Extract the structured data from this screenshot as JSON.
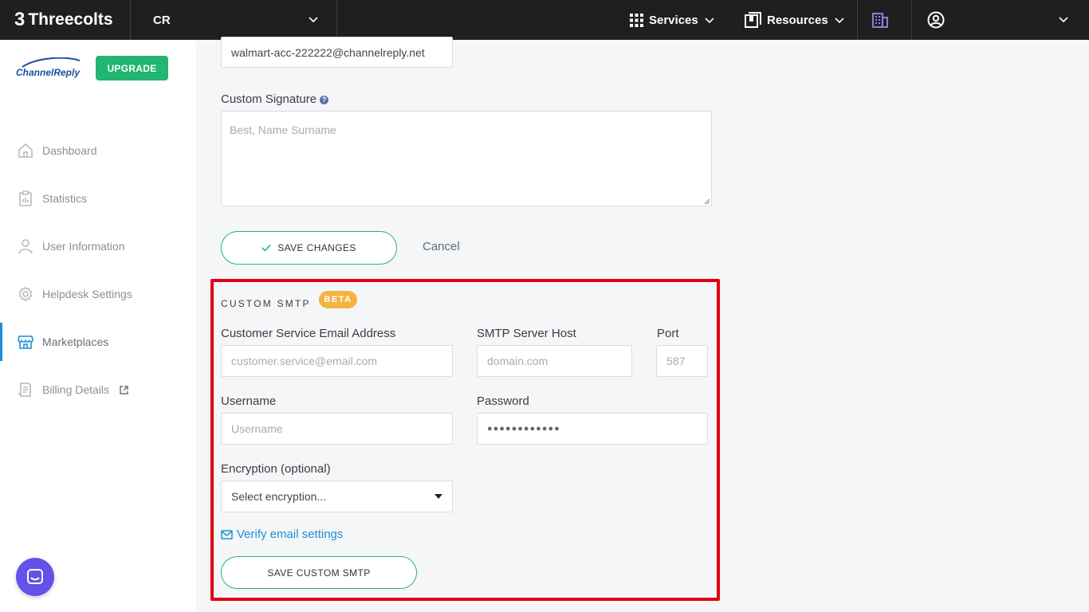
{
  "topbar": {
    "brand": "Threecolts",
    "brand_mark": "3",
    "account": "CR",
    "services_label": "Services",
    "resources_label": "Resources"
  },
  "sidebar": {
    "logo_text": "ChannelReply",
    "upgrade_label": "UPGRADE",
    "items": [
      {
        "label": "Dashboard"
      },
      {
        "label": "Statistics"
      },
      {
        "label": "User Information"
      },
      {
        "label": "Helpdesk Settings"
      },
      {
        "label": "Marketplaces"
      },
      {
        "label": "Billing Details"
      }
    ],
    "active_item": "Marketplaces"
  },
  "form": {
    "email_value": "walmart-acc-222222@channelreply.net",
    "signature_label": "Custom Signature",
    "signature_placeholder": "Best, Name Surname",
    "save_label": "SAVE CHANGES",
    "cancel_label": "Cancel"
  },
  "smtp": {
    "title": "CUSTOM SMTP",
    "badge": "BETA",
    "cs_email_label": "Customer Service Email Address",
    "cs_email_placeholder": "customer.service@email.com",
    "host_label": "SMTP Server Host",
    "host_placeholder": "domain.com",
    "port_label": "Port",
    "port_placeholder": "587",
    "username_label": "Username",
    "username_placeholder": "Username",
    "password_label": "Password",
    "password_value": "●●●●●●●●●●●●",
    "encryption_label": "Encryption (optional)",
    "encryption_value": "Select encryption...",
    "verify_label": "Verify email settings",
    "save_label": "SAVE CUSTOM SMTP"
  },
  "colors": {
    "accent_green": "#22b573",
    "link_blue": "#1e8fd8",
    "highlight_red": "#e00012",
    "beta_orange": "#f5b342",
    "topbar_bg": "#1f1f1f"
  }
}
